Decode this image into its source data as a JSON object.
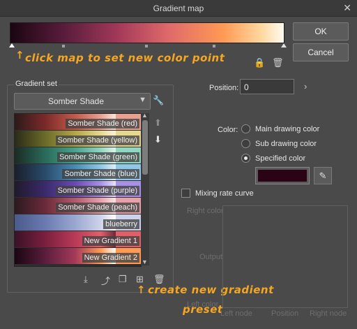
{
  "window": {
    "title": "Gradient map",
    "close": "✕"
  },
  "buttons": {
    "ok": "OK",
    "cancel": "Cancel"
  },
  "annotations": {
    "top": "click map to set new color point",
    "bottom_line1": "create new gradient",
    "bottom_line2": "preset"
  },
  "gradient_set": {
    "label": "Gradient set",
    "selected": "Somber Shade",
    "items": [
      {
        "label": "Somber Shade (red)",
        "colors": [
          "#2b1a1a",
          "#7a2a2a",
          "#c35a4a",
          "#e8a090",
          "#fbe6d8"
        ]
      },
      {
        "label": "Somber Shade (yellow)",
        "colors": [
          "#2b2a18",
          "#6a6a2a",
          "#b3a64a",
          "#e6d890",
          "#fbf4d8"
        ]
      },
      {
        "label": "Somber Shade (green)",
        "colors": [
          "#1a2b24",
          "#2a6a5a",
          "#4aa38a",
          "#90d6c0",
          "#dcf5ec"
        ]
      },
      {
        "label": "Somber Shade (blue)",
        "colors": [
          "#1a1f2b",
          "#2a4a6a",
          "#4a8ab3",
          "#90c6e6",
          "#dcf0fb"
        ]
      },
      {
        "label": "Somber Shade (purple)",
        "colors": [
          "#1f1a2b",
          "#3a2a6a",
          "#6a4ab3",
          "#a890e6",
          "#ece0fb"
        ]
      },
      {
        "label": "Somber Shade (peach)",
        "colors": [
          "#2b1a1f",
          "#6a2a3a",
          "#b35a6a",
          "#e6a0a8",
          "#fbe4e6"
        ]
      },
      {
        "label": "blueberry",
        "colors": [
          "#4a5a8a",
          "#6a7ab0",
          "#9aa8d0",
          "#cdd3ea",
          "#ffffff"
        ]
      },
      {
        "label": "New Gradient 1",
        "colors": [
          "#3a1226",
          "#7a1f3e",
          "#b83a58",
          "#e0606a",
          "#6a2a3a"
        ]
      },
      {
        "label": "New Gradient 2",
        "colors": [
          "#1a0612",
          "#5a1d3c",
          "#a53a5a",
          "#ff9a55",
          "#fffbf0"
        ]
      }
    ]
  },
  "position": {
    "label": "Position:",
    "value": "0"
  },
  "color": {
    "label": "Color:",
    "options": [
      "Main drawing color",
      "Sub drawing color",
      "Specified color"
    ],
    "selected": "Specified color",
    "swatch": "#2a0414"
  },
  "mixing": {
    "label": "Mixing rate curve",
    "checked": false
  },
  "curve": {
    "right_color": "Right color",
    "output": "Output",
    "left_color": "Left color",
    "left_node": "Left node",
    "position": "Position",
    "right_node": "Right node"
  }
}
